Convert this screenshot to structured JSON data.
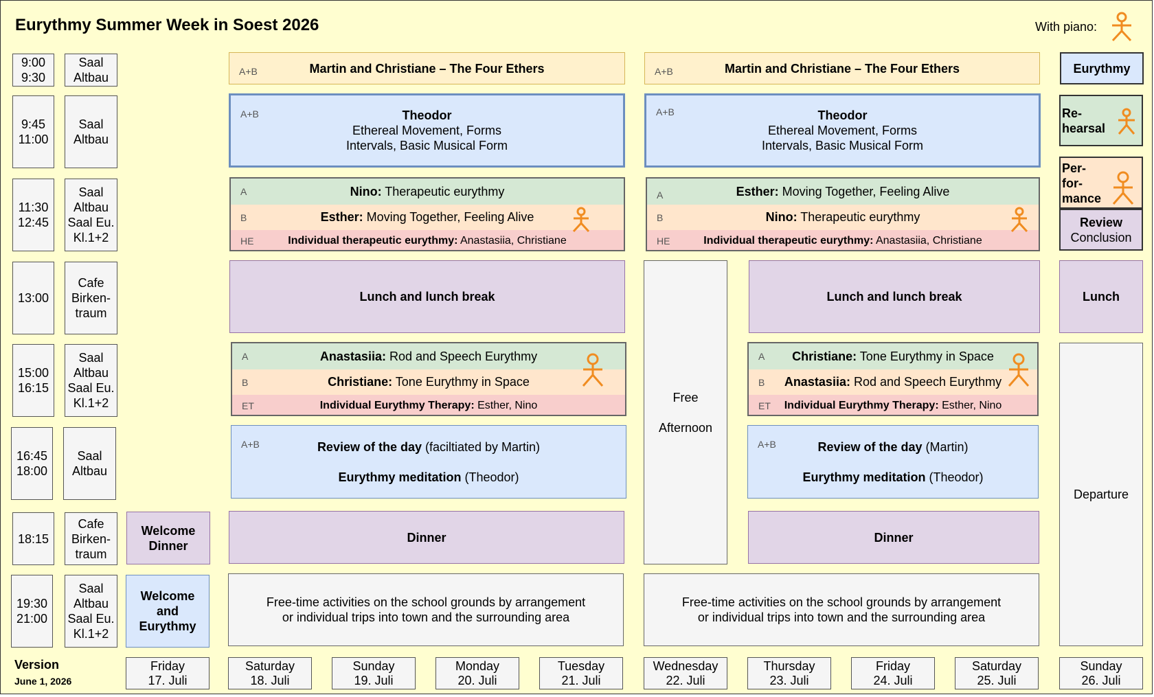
{
  "title": "Eurythmy Summer Week in Soest 2026",
  "legend": {
    "with_piano": "With piano:",
    "eurythmy": "Eurythmy",
    "rehearsal": "Re-\nhearsal",
    "performance": "Per-\nfor-\nmance",
    "review_title": "Review",
    "review_sub": "Conclusion",
    "lunch": "Lunch",
    "departure": "Departure"
  },
  "times": [
    "9:00\n9:30",
    "9:45\n11:00",
    "11:30\n12:45",
    "13:00",
    "15:00\n16:15",
    "16:45\n18:00",
    "18:15",
    "19:30\n21:00"
  ],
  "rooms": [
    "Saal\nAltbau",
    "Saal\nAltbau",
    "Saal\nAltbau\nSaal Eu.\nKl.1+2",
    "Cafe\nBirken-\ntraum",
    "Saal\nAltbau\nSaal Eu.\nKl.1+2",
    "Saal\nAltbau",
    "Cafe\nBirken-\ntraum",
    "Saal\nAltbau\nSaal Eu.\nKl.1+2"
  ],
  "friday": {
    "welcome_dinner": "Welcome\nDinner",
    "welcome_eurythmy": "Welcome\nand\nEurythmy"
  },
  "week1": {
    "ethers_tag": "A+B",
    "ethers": "Martin and Christiane – The Four Ethers",
    "theodor_tag": "A+B",
    "theodor_name": "Theodor",
    "theodor_line1": "Ethereal Movement, Forms",
    "theodor_line2": "Intervals, Basic Musical Form",
    "m_a_tag": "A",
    "m_a_name": "Nino:",
    "m_a_text": " Therapeutic eurythmy",
    "m_b_tag": "B",
    "m_b_name": "Esther:",
    "m_b_text": " Moving Together, Feeling Alive",
    "m_he_tag": "HE",
    "m_he_name": "Individual therapeutic eurythmy:",
    "m_he_text": " Anastasiia, Christiane",
    "lunch": "Lunch and lunch break",
    "a_a_tag": "A",
    "a_a_name": "Anastasiia:",
    "a_a_text": " Rod and Speech Eurythmy",
    "a_b_tag": "B",
    "a_b_name": "Christiane:",
    "a_b_text": " Tone Eurythmy in Space",
    "a_et_tag": "ET",
    "a_et_name": "Individual Eurythmy Therapy:",
    "a_et_text": " Esther, Nino",
    "review_tag": "A+B",
    "review_bold": "Review of the day",
    "review_text": " (faciltiated by Martin)",
    "med_bold": "Eurythmy meditation",
    "med_text": " (Theodor)",
    "dinner": "Dinner",
    "free_line1": "Free-time activities on the school grounds by arrangement",
    "free_line2": "or individual trips into town and the surrounding area"
  },
  "wednesday": {
    "free": "Free",
    "afternoon": "Afternoon"
  },
  "week2": {
    "ethers_tag": "A+B",
    "ethers": "Martin and Christiane – The Four Ethers",
    "theodor_tag": "A+B",
    "theodor_name": "Theodor",
    "theodor_line1": "Ethereal Movement, Forms",
    "theodor_line2": "Intervals, Basic Musical Form",
    "m_a_tag": "A",
    "m_a_name": "Esther:",
    "m_a_text": " Moving Together, Feeling Alive",
    "m_b_tag": "B",
    "m_b_name": "Nino:",
    "m_b_text": " Therapeutic eurythmy",
    "m_he_tag": "HE",
    "m_he_name": "Individual therapeutic eurythmy:",
    "m_he_text": " Anastasiia, Christiane",
    "lunch": "Lunch and lunch break",
    "a_a_tag": "A",
    "a_a_name": "Christiane:",
    "a_a_text": " Tone Eurythmy in Space",
    "a_b_tag": "B",
    "a_b_name": "Anastasiia:",
    "a_b_text": " Rod and Speech Eurythmy",
    "a_et_tag": "ET",
    "a_et_name": "Individual Eurythmy Therapy:",
    "a_et_text": " Esther, Nino",
    "review_tag": "A+B",
    "review_bold": "Review of the day",
    "review_text": " (Martin)",
    "med_bold": "Eurythmy meditation",
    "med_text": " (Theodor)",
    "dinner": "Dinner",
    "free_line1": "Free-time activities on the school grounds by arrangement",
    "free_line2": "or individual trips into town and the surrounding area"
  },
  "version": {
    "label": "Version",
    "date": "June 1, 2026"
  },
  "days": [
    {
      "name": "Friday",
      "date": "17. Juli"
    },
    {
      "name": "Saturday",
      "date": "18. Juli"
    },
    {
      "name": "Sunday",
      "date": "19. Juli"
    },
    {
      "name": "Monday",
      "date": "20. Juli"
    },
    {
      "name": "Tuesday",
      "date": "21. Juli"
    },
    {
      "name": "Wednesday",
      "date": "22. Juli"
    },
    {
      "name": "Thursday",
      "date": "23. Juli"
    },
    {
      "name": "Friday",
      "date": "24. Juli"
    },
    {
      "name": "Saturday",
      "date": "25. Juli"
    },
    {
      "name": "Sunday",
      "date": "26. Juli"
    }
  ],
  "colors": {
    "background": "#fffed0",
    "blue": "#dae8fc",
    "purple": "#e1d5e7",
    "green": "#d5e8d4",
    "orange": "#ffe6cc",
    "pink": "#f8cecc",
    "grey": "#f5f5f5",
    "yellow": "#fff1cc",
    "figure": "#f08c20"
  },
  "icons": {
    "piano": "stick-figure-icon"
  }
}
